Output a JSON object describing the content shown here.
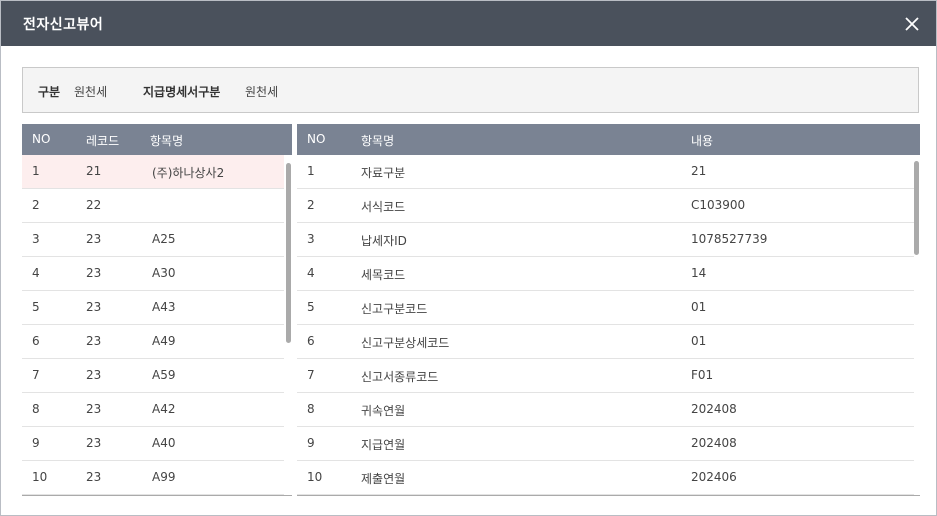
{
  "window": {
    "title": "전자신고뷰어"
  },
  "filter": {
    "label1": "구분",
    "value1": "원천세",
    "label2": "지급명세서구분",
    "value2": "원천세"
  },
  "left_table": {
    "headers": [
      "NO",
      "레코드",
      "항목명"
    ],
    "rows": [
      {
        "no": "1",
        "record": "21",
        "name": "(주)하나상사2"
      },
      {
        "no": "2",
        "record": "22",
        "name": ""
      },
      {
        "no": "3",
        "record": "23",
        "name": "A25"
      },
      {
        "no": "4",
        "record": "23",
        "name": "A30"
      },
      {
        "no": "5",
        "record": "23",
        "name": "A43"
      },
      {
        "no": "6",
        "record": "23",
        "name": "A49"
      },
      {
        "no": "7",
        "record": "23",
        "name": "A59"
      },
      {
        "no": "8",
        "record": "23",
        "name": "A42"
      },
      {
        "no": "9",
        "record": "23",
        "name": "A40"
      },
      {
        "no": "10",
        "record": "23",
        "name": "A99"
      }
    ]
  },
  "right_table": {
    "headers": [
      "NO",
      "항목명",
      "내용"
    ],
    "rows": [
      {
        "no": "1",
        "item": "자료구분",
        "content": "21"
      },
      {
        "no": "2",
        "item": "서식코드",
        "content": "C103900"
      },
      {
        "no": "3",
        "item": "납세자ID",
        "content": "1078527739"
      },
      {
        "no": "4",
        "item": "세목코드",
        "content": "14"
      },
      {
        "no": "5",
        "item": "신고구분코드",
        "content": "01"
      },
      {
        "no": "6",
        "item": "신고구분상세코드",
        "content": "01"
      },
      {
        "no": "7",
        "item": "신고서종류코드",
        "content": "F01"
      },
      {
        "no": "8",
        "item": "귀속연월",
        "content": "202408"
      },
      {
        "no": "9",
        "item": "지급연월",
        "content": "202408"
      },
      {
        "no": "10",
        "item": "제출연월",
        "content": "202406"
      }
    ]
  }
}
